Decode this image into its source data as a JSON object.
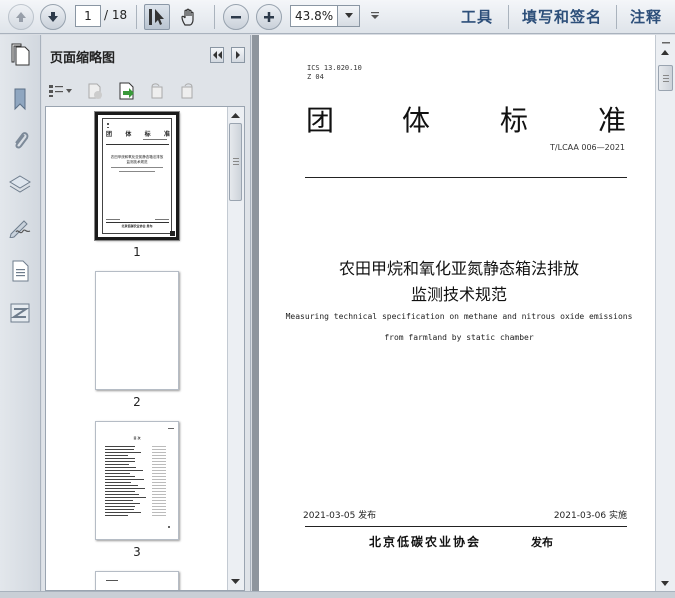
{
  "toolbar": {
    "page_current": "1",
    "page_total": "/ 18",
    "zoom": "43.8%",
    "links": [
      "工具",
      "填写和签名",
      "注释"
    ]
  },
  "icons": {
    "prev": "arrow-up-icon",
    "next": "arrow-down-icon",
    "select": "select-cursor-icon",
    "hand": "hand-icon",
    "zoom_out": "minus-icon",
    "zoom_in": "plus-icon"
  },
  "sidebar": {
    "title": "页面缩略图",
    "thumbnails": [
      {
        "label": "1",
        "selected": true
      },
      {
        "label": "2",
        "selected": false
      },
      {
        "label": "3",
        "selected": false
      }
    ],
    "thumb1": {
      "code_line1": "ICS 13.020.10",
      "code_line2": "Z 04",
      "title_chars": [
        "团",
        "体",
        "标",
        "准"
      ],
      "doc_title": "农田甲烷和氧化亚氮静态箱法排放",
      "doc_title2": "监测技术规范",
      "footer": "北京低碳农业协会  发布"
    },
    "thumb3": {
      "heading": "目  次"
    }
  },
  "document": {
    "ics": "ICS 13.020.10",
    "z": "Z 04",
    "title_chars": [
      "团",
      "体",
      "标",
      "准"
    ],
    "code": "T/LCAA 006—2021",
    "cn_title_line1": "农田甲烷和氧化亚氮静态箱法排放",
    "cn_title_line2": "监测技术规范",
    "en_title_line1": "Measuring technical specification on methane and nitrous oxide emissions",
    "en_title_line2": "from farmland by static chamber",
    "publish_date": "2021-03-05 发布",
    "implement_date": "2021-03-06 实施",
    "org": "北京低碳农业协会",
    "publish_word": "发布"
  },
  "colors": {
    "link": "#2d4f7a",
    "doc_background": "#8e959d"
  }
}
